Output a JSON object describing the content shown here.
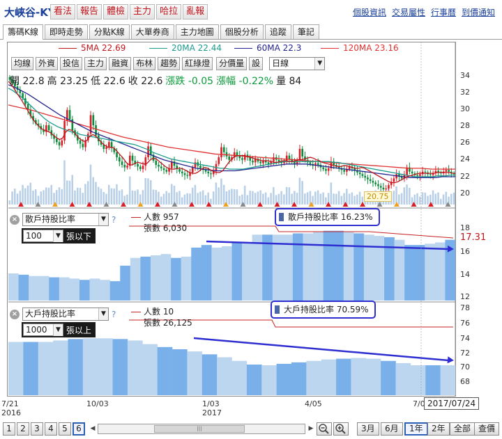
{
  "header": {
    "stock_name": "大峽谷-KY",
    "buttons": [
      "看法",
      "報告",
      "體檢",
      "主力",
      "哈拉",
      "亂報"
    ],
    "links": [
      "個股資訊",
      "交易屬性",
      "行事曆",
      "到價通知"
    ]
  },
  "tabs": [
    "籌碼K線",
    "即時走勢",
    "分點K線",
    "大單券商",
    "主力地圖",
    "個股分析",
    "追蹤",
    "筆記"
  ],
  "active_tab": 0,
  "ma_legend": [
    {
      "label": "5MA 22.69",
      "color": "#c0141b"
    },
    {
      "label": "20MA 22.44",
      "color": "#1a9c8c"
    },
    {
      "label": "60MA 22.3",
      "color": "#23238f"
    },
    {
      "label": "120MA 23.16",
      "color": "#e03030"
    }
  ],
  "toolbar": {
    "buttons": [
      "均線",
      "外資",
      "投信",
      "主力",
      "融資",
      "布林",
      "趨勢",
      "紅綠燈",
      "分價量",
      "設"
    ],
    "period": "日線"
  },
  "quote": {
    "open": "開 22.8",
    "high": "高 23.25",
    "low": "低 22.6",
    "close": "收 22.6",
    "change": "漲跌 -0.05",
    "change_pct": "漲幅 -0.22%",
    "volume": "量 84"
  },
  "price_axis": [
    "34",
    "32",
    "30",
    "28",
    "26",
    "24",
    "22",
    "20"
  ],
  "low_label": "20.75",
  "panel1": {
    "select": "散戶持股比率",
    "threshold": "100",
    "threshold_label": "張以下",
    "legend_people": "人數 957",
    "legend_shares": "張數 6,030",
    "ratio_text": "散戶持股比率 16.23%",
    "axis": [
      "18",
      "16",
      "14",
      "12"
    ],
    "value_tag": "17.31"
  },
  "panel2": {
    "select": "大戶持股比率",
    "threshold": "1000",
    "threshold_label": "張以上",
    "legend_people": "人數 10",
    "legend_shares": "張數 26,125",
    "ratio_text": "大戶持股比率 70.59%",
    "axis": [
      "78",
      "76",
      "74",
      "72",
      "70",
      "68"
    ]
  },
  "x_axis": [
    {
      "date": "7/21",
      "year": "2016"
    },
    {
      "date": "10/03",
      "year": ""
    },
    {
      "date": "1/03",
      "year": "2017"
    },
    {
      "date": "4/05",
      "year": ""
    },
    {
      "date": "7/0",
      "year": ""
    }
  ],
  "cursor_date": "2017/07/24",
  "bottom": {
    "pages": [
      "1",
      "2",
      "3",
      "4",
      "5",
      "6"
    ],
    "active_page": 5,
    "ranges": [
      "3月",
      "6月",
      "1年",
      "2年",
      "全部",
      "查價"
    ],
    "active_range": 2
  },
  "colors": {
    "up": "#d81f26",
    "down": "#0a8a3a",
    "bar_light": "#bcd6f0",
    "bar_dark": "#7ab0ea",
    "arrow": "#2d2dd1"
  },
  "chart_data": {
    "type": "candlestick",
    "price_range": [
      19,
      35
    ],
    "closes": [
      33.8,
      33.4,
      33.0,
      32.6,
      32.2,
      31.6,
      30.9,
      30.2,
      29.5,
      29.0,
      28.6,
      28.3,
      27.9,
      27.6,
      28.4,
      27.8,
      27.2,
      26.8,
      26.4,
      26.0,
      26.6,
      28.9,
      30.2,
      29.1,
      27.8,
      27.2,
      26.6,
      26.2,
      25.8,
      26.6,
      27.4,
      29.6,
      28.4,
      27.2,
      26.5,
      26.1,
      25.6,
      25.8,
      26.4,
      25.7,
      25.2,
      24.6,
      24.1,
      23.7,
      23.4,
      23.6,
      24.8,
      24.2,
      23.8,
      23.5,
      23.2,
      23.6,
      24.6,
      25.9,
      24.9,
      24.2,
      23.7,
      23.5,
      23.3,
      23.1,
      22.9,
      23.3,
      24.1,
      23.6,
      23.2,
      22.9,
      22.7,
      22.5,
      22.4,
      22.8,
      23.4,
      24.0,
      23.6,
      23.3,
      23.1,
      22.9,
      22.7,
      22.6,
      23.0,
      23.8,
      24.6,
      25.8,
      25.2,
      24.7,
      24.3,
      24.6,
      25.2,
      24.8,
      24.5,
      24.3,
      24.9,
      24.6,
      24.2,
      24.0,
      24.4,
      24.1,
      23.9,
      24.2,
      24.0,
      23.8,
      24.1,
      24.6,
      24.3,
      24.1,
      23.9,
      24.2,
      24.8,
      24.4,
      24.1,
      23.8,
      24.3,
      25.6,
      24.7,
      24.3,
      24.0,
      23.8,
      23.6,
      23.9,
      23.7,
      23.4,
      23.2,
      23.0,
      23.3,
      24.1,
      23.7,
      23.5,
      23.3,
      23.1,
      22.9,
      23.2,
      23.5,
      23.3,
      23.0,
      22.8,
      22.6,
      22.4,
      22.2,
      22.0,
      21.8,
      21.6,
      21.4,
      21.2,
      21.0,
      20.8,
      20.9,
      21.3,
      21.7,
      22.1,
      22.6,
      22.3,
      22.1,
      22.5,
      23.4,
      22.9,
      22.7,
      22.5,
      22.4,
      22.6,
      22.9,
      22.8,
      22.6,
      22.5,
      22.7,
      23.0,
      22.8,
      22.7,
      22.9,
      23.1,
      22.9,
      22.7,
      22.6
    ],
    "ma5": [
      33.6,
      33.2,
      32.7,
      32.1,
      31.6,
      31.0,
      30.4,
      29.8,
      29.2,
      28.7,
      28.3,
      28.0,
      27.8,
      27.7,
      27.5,
      27.2,
      26.9,
      26.7,
      26.9,
      27.6,
      27.9,
      27.8,
      27.5,
      27.0,
      26.7,
      26.5,
      26.6,
      27.1,
      27.3,
      27.1,
      26.7,
      26.3,
      26.0,
      25.8,
      25.8,
      25.7,
      25.3,
      24.9,
      24.5,
      24.0,
      23.7,
      23.7,
      23.9,
      24.0,
      23.9,
      23.8,
      23.9,
      24.3,
      24.5,
      24.4,
      24.1,
      23.8,
      23.5,
      23.3,
      23.2,
      23.2,
      23.3,
      23.3,
      23.2,
      23.0,
      22.8,
      22.7,
      22.7,
      22.9,
      23.2,
      23.4,
      23.3,
      23.1,
      22.9,
      22.8,
      22.8,
      23.0,
      23.5,
      24.0,
      24.4,
      24.7,
      24.8,
      24.8,
      24.8,
      24.7,
      24.6,
      24.5,
      24.4,
      24.3,
      24.2,
      24.2,
      24.2,
      24.1,
      24.0,
      24.0,
      24.1,
      24.2,
      24.2,
      24.1,
      24.1,
      24.2,
      24.3,
      24.3,
      24.4,
      24.5,
      24.6,
      24.5,
      24.3,
      24.2,
      24.0,
      23.9,
      23.8,
      23.7,
      23.6,
      23.5,
      23.5,
      23.6,
      23.6,
      23.5,
      23.4,
      23.3,
      23.3,
      23.4,
      23.3,
      23.1,
      22.9,
      22.7,
      22.5,
      22.3,
      22.1,
      21.9,
      21.7,
      21.6,
      21.6,
      21.7,
      21.9,
      22.1,
      22.3,
      22.4,
      22.5,
      22.6,
      22.7,
      22.7,
      22.7,
      22.7,
      22.7,
      22.7,
      22.8,
      22.8,
      22.8,
      22.8,
      22.8,
      22.7,
      22.7
    ],
    "ma20": [
      32.8,
      32.5,
      32.1,
      31.7,
      31.2,
      30.7,
      30.2,
      29.7,
      29.2,
      28.8,
      28.5,
      28.2,
      28.0,
      27.8,
      27.6,
      27.5,
      27.3,
      27.2,
      27.1,
      27.0,
      26.9,
      26.8,
      26.7,
      26.6,
      26.5,
      26.4,
      26.3,
      26.2,
      26.1,
      25.9,
      25.7,
      25.5,
      25.2,
      25.0,
      24.8,
      24.6,
      24.4,
      24.3,
      24.2,
      24.1,
      24.0,
      23.9,
      23.8,
      23.7,
      23.6,
      23.5,
      23.4,
      23.3,
      23.3,
      23.2,
      23.2,
      23.2,
      23.2,
      23.3,
      23.4,
      23.5,
      23.6,
      23.7,
      23.8,
      23.9,
      24.0,
      24.1,
      24.1,
      24.1,
      24.1,
      24.1,
      24.1,
      24.1,
      24.1,
      24.1,
      24.1,
      24.1,
      24.0,
      24.0,
      23.9,
      23.8,
      23.7,
      23.6,
      23.5,
      23.4,
      23.3,
      23.2,
      23.1,
      23.0,
      22.9,
      22.8,
      22.7,
      22.6,
      22.5,
      22.4,
      22.3,
      22.3,
      22.3,
      22.3,
      22.3,
      22.4,
      22.4,
      22.4,
      22.5,
      22.5
    ],
    "ma60": [
      33.2,
      32.9,
      32.5,
      32.1,
      31.6,
      31.1,
      30.6,
      30.1,
      29.6,
      29.2,
      28.8,
      28.4,
      28.0,
      27.6,
      27.3,
      27.0,
      26.7,
      26.4,
      26.1,
      25.8,
      25.5,
      25.2,
      24.9,
      24.6,
      24.3,
      24.1,
      23.9,
      23.7,
      23.5,
      23.3,
      23.2,
      23.1,
      23.0,
      23.0,
      23.0,
      23.0,
      23.1,
      23.2,
      23.3,
      23.4,
      23.5,
      23.6,
      23.7,
      23.8,
      23.8,
      23.8,
      23.8,
      23.7,
      23.6,
      23.5,
      23.4,
      23.3,
      23.2,
      23.1,
      23.0,
      22.9,
      22.8,
      22.7,
      22.6,
      22.5,
      22.4,
      22.3,
      22.2,
      22.2,
      22.2,
      22.2,
      22.2,
      22.3,
      22.3,
      22.3
    ],
    "ma120": [
      30.8,
      30.5,
      30.2,
      29.8,
      29.4,
      29.0,
      28.6,
      28.2,
      27.8,
      27.4,
      27.0,
      26.7,
      26.4,
      26.1,
      25.8,
      25.6,
      25.4,
      25.2,
      25.0,
      24.9,
      24.8,
      24.7,
      24.6,
      24.5,
      24.4,
      24.3,
      24.2,
      24.1,
      24.0,
      23.9,
      23.8,
      23.7,
      23.6,
      23.5,
      23.4,
      23.3,
      23.3,
      23.2,
      23.2,
      23.2
    ],
    "panel1_levels": [
      13.6,
      13.5,
      13.4,
      13.4,
      13.3,
      13.3,
      13.2,
      13.1,
      13.2,
      13.1,
      13.0,
      14.2,
      14.8,
      14.9,
      15.0,
      15.1,
      14.8,
      14.9,
      15.6,
      15.8,
      15.6,
      15.7,
      16.0,
      16.0,
      16.6,
      16.6,
      16.6,
      16.6,
      16.7,
      16.7,
      16.8,
      16.9,
      16.9,
      16.8,
      16.7,
      16.6,
      16.5,
      16.4,
      16.2,
      15.8,
      15.8,
      15.9,
      16.0,
      16.2
    ],
    "panel1_range": [
      11.5,
      18.5
    ],
    "panel2_levels": [
      73.8,
      73.8,
      73.8,
      74.0,
      74.2,
      74.3,
      74.3,
      74.2,
      74.0,
      73.5,
      73.1,
      72.8,
      72.5,
      72.1,
      71.7,
      71.2,
      70.7,
      70.6,
      70.8,
      71.0,
      71.2,
      71.4,
      71.5,
      71.6,
      71.5,
      71.2,
      70.9,
      70.6,
      70.6,
      70.6
    ],
    "panel2_range": [
      66.5,
      79
    ]
  }
}
